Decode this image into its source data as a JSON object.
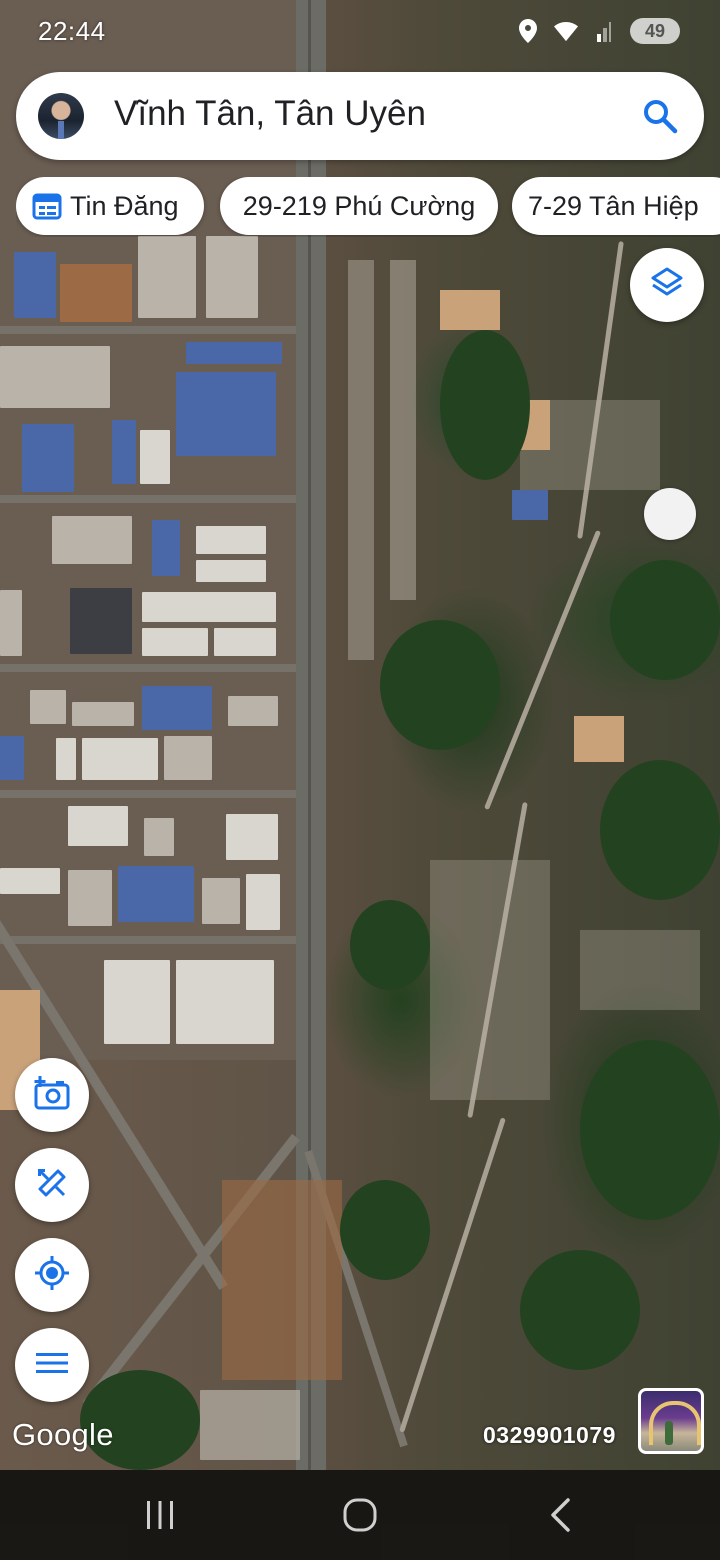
{
  "status_bar": {
    "time": "22:44",
    "battery": "49",
    "icons": [
      "location-icon",
      "wifi-icon",
      "signal-icon",
      "battery-icon"
    ]
  },
  "search": {
    "query": "Vĩnh Tân, Tân Uyên",
    "icon": "search-icon"
  },
  "chips": [
    {
      "label": "Tin Đăng",
      "icon": "calendar-list-icon"
    },
    {
      "label": "29-219 Phú Cường"
    },
    {
      "label": "7-29 Tân Hiệp"
    }
  ],
  "map_controls": {
    "layers": "layers-icon",
    "camera": "add-photo-icon",
    "measure": "measure-tools-icon",
    "my_location": "my-location-icon",
    "menu": "menu-icon"
  },
  "map": {
    "view": "satellite",
    "provider_logo": "Google",
    "watermark_phone": "0329901079",
    "accent_color": "#1a73e8"
  },
  "nav_bar": {
    "buttons": [
      "recent-apps-icon",
      "home-icon",
      "back-icon"
    ]
  }
}
